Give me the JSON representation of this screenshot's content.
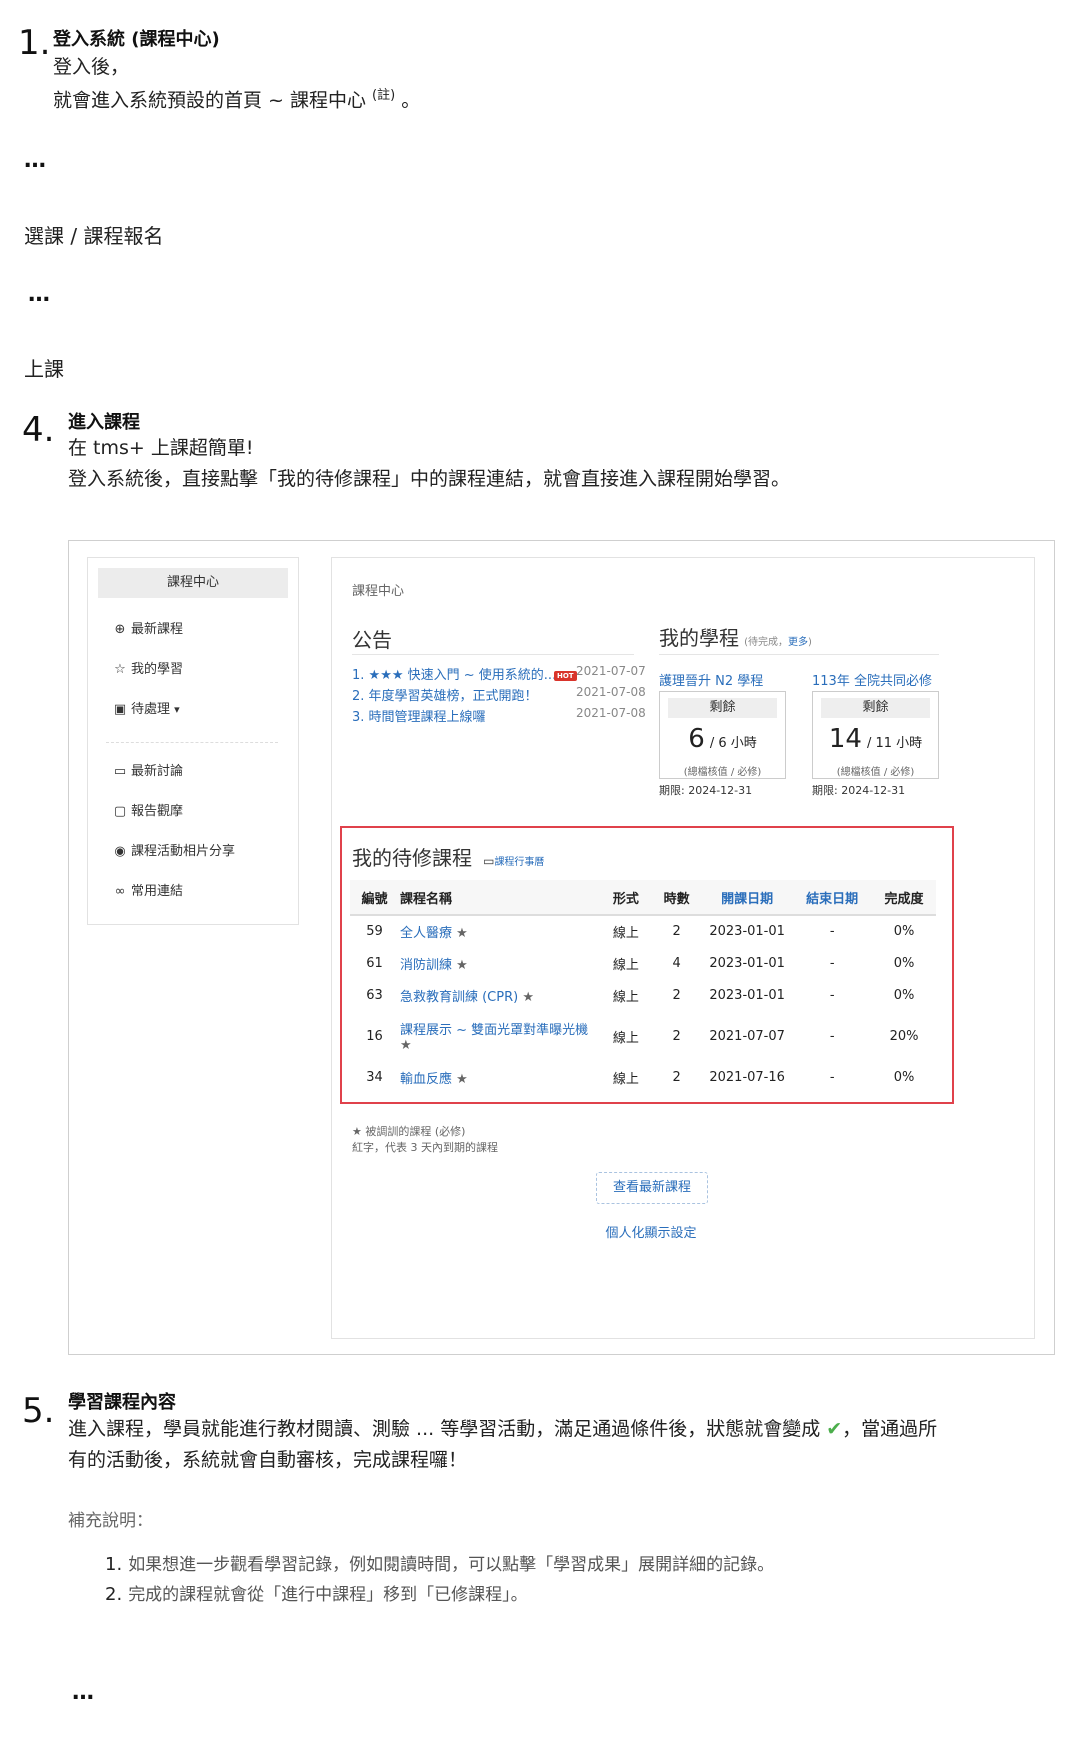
{
  "step1": {
    "number": "1.",
    "title": "登入系統 (課程中心)",
    "line1": "登入後，",
    "line2": "就會進入系統預設的首頁 ~ 課程中心",
    "note_mark": "(註)",
    "line2_end": "。"
  },
  "ellipsis1": "…",
  "course_select": "選課 / 課程報名",
  "ellipsis2": "…",
  "attend": "上課",
  "step4": {
    "number": "4.",
    "title": "進入課程",
    "line1": "在 tms+ 上課超簡單!",
    "line2": "登入系統後，直接點擊「我的待修課程」中的課程連結，就會直接進入課程開始學習。"
  },
  "screenshot": {
    "sidebar": {
      "header": "課程中心",
      "items": [
        {
          "icon": "search-plus-icon",
          "glyph": "⊕",
          "label": "最新課程"
        },
        {
          "icon": "star-outline-icon",
          "glyph": "☆",
          "label": "我的學習"
        },
        {
          "icon": "briefcase-icon",
          "glyph": "▣",
          "label": "待處理"
        },
        {
          "icon": "comment-icon",
          "glyph": "▭",
          "label": "最新討論"
        },
        {
          "icon": "report-icon",
          "glyph": "▢",
          "label": "報告觀摩"
        },
        {
          "icon": "camera-icon",
          "glyph": "◉",
          "label": "課程活動相片分享"
        },
        {
          "icon": "link-icon",
          "glyph": "∞",
          "label": "常用連結"
        }
      ],
      "dropdown_caret": "▾"
    },
    "breadcrumb": "課程中心",
    "announcements": {
      "title": "公告",
      "items": [
        {
          "num": "1.",
          "text": "★★★ 快速入門 ~ 使用系統的...",
          "hot": "HOT",
          "date": "2021-07-07"
        },
        {
          "num": "2.",
          "text": "年度學習英雄榜，正式開跑！",
          "hot": "",
          "date": "2021-07-08"
        },
        {
          "num": "3.",
          "text": "時間管理課程上線囉",
          "hot": "",
          "date": "2021-07-08"
        }
      ]
    },
    "my_programs": {
      "title": "我的學程",
      "subtitle": "(待完成，",
      "more": "更多",
      "subtitle_end": ")",
      "programs": [
        {
          "name": "護理晉升 N2 學程",
          "remain_label": "剩餘",
          "value": "6",
          "total": "/ 6 小時",
          "note": "(總檔核值 / 必修)",
          "deadline": "期限: 2024-12-31"
        },
        {
          "name": "113年 全院共同必修",
          "remain_label": "剩餘",
          "value": "14",
          "total": "/ 11 小時",
          "note": "(總檔核值 / 必修)",
          "deadline": "期限: 2024-12-31"
        }
      ]
    },
    "pending": {
      "title": "我的待修課程",
      "calendar_link": "課程行事曆",
      "columns": [
        "編號",
        "課程名稱",
        "形式",
        "時數",
        "開課日期",
        "結束日期",
        "完成度"
      ],
      "rows": [
        {
          "id": "59",
          "name": "全人醫療",
          "form": "線上",
          "hours": "2",
          "start": "2023-01-01",
          "end": "-",
          "progress": "0%"
        },
        {
          "id": "61",
          "name": "消防訓練",
          "form": "線上",
          "hours": "4",
          "start": "2023-01-01",
          "end": "-",
          "progress": "0%"
        },
        {
          "id": "63",
          "name": "急救教育訓練 (CPR)",
          "form": "線上",
          "hours": "2",
          "start": "2023-01-01",
          "end": "-",
          "progress": "0%"
        },
        {
          "id": "16",
          "name": "課程展示 ~ 雙面光罩對準曝光機",
          "form": "線上",
          "hours": "2",
          "start": "2021-07-07",
          "end": "-",
          "progress": "20%"
        },
        {
          "id": "34",
          "name": "輸血反應",
          "form": "線上",
          "hours": "2",
          "start": "2021-07-16",
          "end": "-",
          "progress": "0%"
        }
      ],
      "star": "★"
    },
    "footnote1": "★ 被調訓的課程 (必修)",
    "footnote2": "紅字，代表 3 天內到期的課程",
    "view_latest_btn": "查看最新課程",
    "personalize_link": "個人化顯示設定"
  },
  "step5": {
    "number": "5.",
    "title": "學習課程內容",
    "line1a": "進入課程，學員就能進行教材閱讀、測驗 ... 等學習活動，滿足通過條件後，狀態就會變成",
    "check": "✔",
    "line1b": "，當通過所",
    "line2": "有的活動後，系統就會自動審核，完成課程囉！"
  },
  "supplement": {
    "title": "補充說明：",
    "items": [
      {
        "num": "1.",
        "text": "如果想進一步觀看學習記錄，例如閱讀時間，可以點擊「學習成果」展開詳細的記錄。"
      },
      {
        "num": "2.",
        "text": "完成的課程就會從「進行中課程」移到「已修課程」。"
      }
    ]
  },
  "ellipsis3": "…"
}
